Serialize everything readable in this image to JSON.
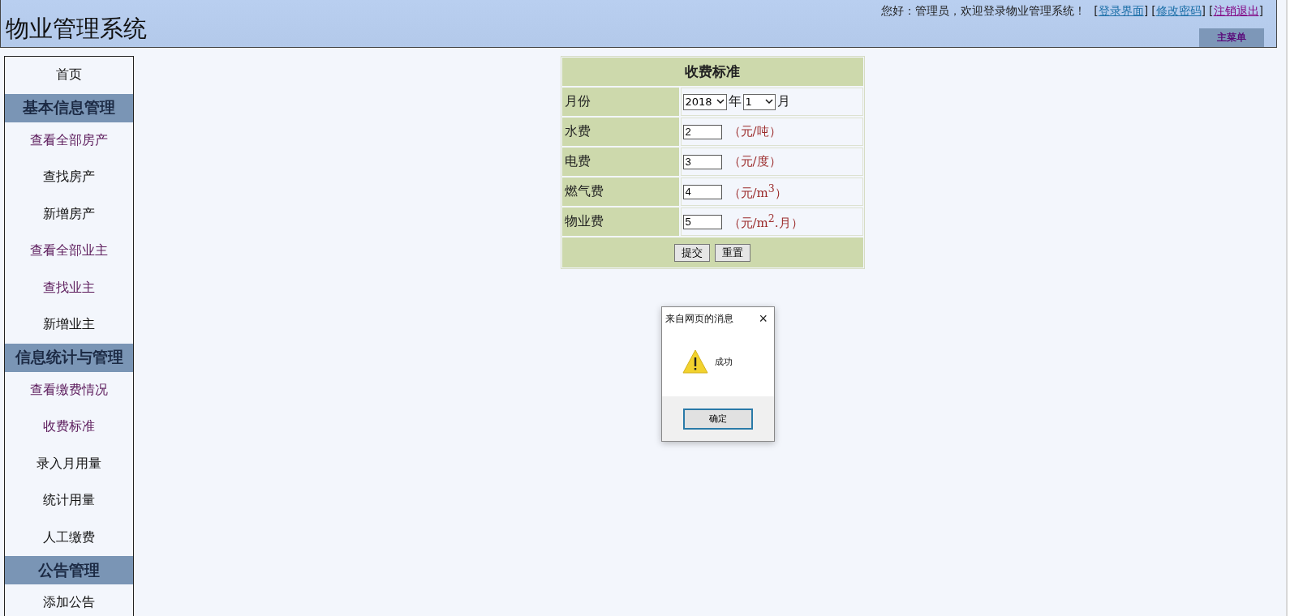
{
  "header": {
    "title": "物业管理系统",
    "greeting": "您好：管理员，欢迎登录物业管理系统！",
    "links": [
      {
        "open": "[",
        "label": "登录界面",
        "close": "]",
        "visited": false
      },
      {
        "open": "[",
        "label": "修改密码",
        "close": "]",
        "visited": false
      },
      {
        "open": "[",
        "label": "注销退出",
        "close": "]",
        "visited": true
      }
    ],
    "menu_button": "主菜单"
  },
  "sidebar": {
    "items": [
      {
        "kind": "link",
        "label": "首页",
        "visited": false
      },
      {
        "kind": "section",
        "label": "基本信息管理"
      },
      {
        "kind": "link",
        "label": "查看全部房产",
        "visited": true
      },
      {
        "kind": "link",
        "label": "查找房产",
        "visited": false
      },
      {
        "kind": "link",
        "label": "新增房产",
        "visited": false
      },
      {
        "kind": "link",
        "label": "查看全部业主",
        "visited": true
      },
      {
        "kind": "link",
        "label": "查找业主",
        "visited": true
      },
      {
        "kind": "link",
        "label": "新增业主",
        "visited": false
      },
      {
        "kind": "section",
        "label": "信息统计与管理"
      },
      {
        "kind": "link",
        "label": "查看缴费情况",
        "visited": true
      },
      {
        "kind": "link",
        "label": "收费标准",
        "visited": true
      },
      {
        "kind": "link",
        "label": "录入月用量",
        "visited": false
      },
      {
        "kind": "link",
        "label": "统计用量",
        "visited": false
      },
      {
        "kind": "link",
        "label": "人工缴费",
        "visited": false
      },
      {
        "kind": "section",
        "label": "公告管理"
      },
      {
        "kind": "link",
        "label": "添加公告",
        "visited": false
      }
    ]
  },
  "form": {
    "title": "收费标准",
    "month_row": {
      "label": "月份",
      "year": "2018",
      "year_unit": "年",
      "month": "1",
      "month_unit": "月"
    },
    "rows": [
      {
        "label": "水费",
        "value": "2",
        "unit": "（元/吨）"
      },
      {
        "label": "电费",
        "value": "3",
        "unit": "（元/度）"
      },
      {
        "label": "燃气费",
        "value": "4",
        "unit": "（元/m$^{3}$）"
      },
      {
        "label": "物业费",
        "value": "5",
        "unit": "（元/m$^{2}$.月）"
      }
    ],
    "buttons": [
      "提交",
      "重置"
    ]
  },
  "dialog": {
    "title": "来自网页的消息",
    "close": "×",
    "message": "成功",
    "button": "确定"
  }
}
